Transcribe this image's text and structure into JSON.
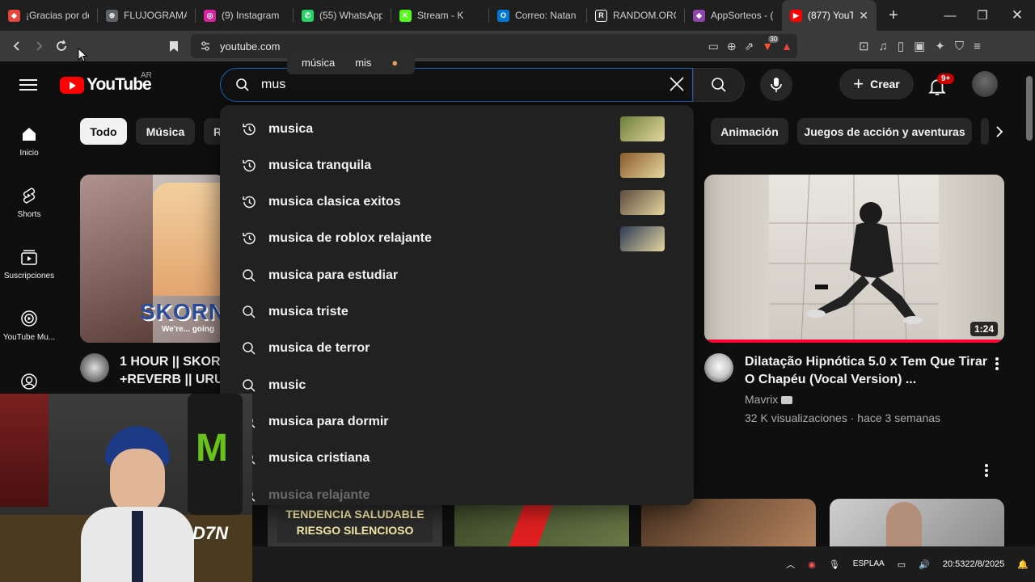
{
  "browser": {
    "tabs": [
      {
        "title": "¡Gracias por de",
        "fav_color": "#e8453c",
        "fav_glyph": "◆"
      },
      {
        "title": "FLUJOGRAMA",
        "fav_color": "#5f6368",
        "fav_glyph": "⊕"
      },
      {
        "title": "(9) Instagram",
        "fav_color": "#d6249f",
        "fav_glyph": "◎"
      },
      {
        "title": "(55) WhatsApp",
        "fav_color": "#25d366",
        "fav_glyph": "✆"
      },
      {
        "title": "Stream - K",
        "fav_color": "#53fc18",
        "fav_glyph": "K"
      },
      {
        "title": "Correo: Natan",
        "fav_color": "#0078d4",
        "fav_glyph": "O"
      },
      {
        "title": "RANDOM.ORG",
        "fav_color": "#ffffff",
        "fav_glyph": "R"
      },
      {
        "title": "AppSorteos - (",
        "fav_color": "#8e44ad",
        "fav_glyph": "◆"
      },
      {
        "title": "(877) YouT",
        "fav_color": "#ff0000",
        "fav_glyph": "▶"
      }
    ],
    "url": "youtube.com",
    "brave_count": "30"
  },
  "voice_hint": {
    "word1": "música",
    "word2": "mis"
  },
  "header": {
    "logo_text": "YouTube",
    "country": "AR",
    "search_value": "mus",
    "create_label": "Crear",
    "notif_badge": "9+"
  },
  "sidebar": {
    "items": [
      {
        "label": "Inicio",
        "icon": "home-icon"
      },
      {
        "label": "Shorts",
        "icon": "shorts-icon"
      },
      {
        "label": "Suscripciones",
        "icon": "subscriptions-icon"
      },
      {
        "label": "YouTube Mu...",
        "icon": "youtube-music-icon"
      },
      {
        "label": "",
        "icon": "account-icon"
      }
    ]
  },
  "chips": [
    "Todo",
    "Música",
    "R",
    "Animación",
    "Juegos de acción y aventuras"
  ],
  "suggestions": [
    {
      "text": "musica",
      "kind": "history",
      "thumb": "#6c7f3a"
    },
    {
      "text": "musica tranquila",
      "kind": "history",
      "thumb": "#8a5a2a"
    },
    {
      "text": "musica clasica exitos",
      "kind": "history",
      "thumb": "#5b4a3c"
    },
    {
      "text": "musica de roblox relajante",
      "kind": "history",
      "thumb": "#2c3b55"
    },
    {
      "text": "musica para estudiar",
      "kind": "search"
    },
    {
      "text": "musica triste",
      "kind": "search"
    },
    {
      "text": "musica de terror",
      "kind": "search"
    },
    {
      "text": "music",
      "kind": "search"
    },
    {
      "text": "musica para dormir",
      "kind": "search"
    },
    {
      "text": "musica cristiana",
      "kind": "search"
    },
    {
      "text": "musica relajante",
      "kind": "search"
    }
  ],
  "videos": {
    "left": {
      "title_line1": "1 HOUR || SKORN",
      "title_line2": "+REVERB || URUM",
      "overlay_text": "SKORN",
      "overlay_sub": "We're... going"
    },
    "right": {
      "title": "Dilatação Hipnótica 5.0 x Tem Que Tirar O Chapéu (Vocal Version) ...",
      "channel": "Mavrix",
      "meta": "32 K visualizaciones · hace 3 semanas",
      "duration": "1:24"
    },
    "shorts_row": {
      "thumb1_line1": "TENDENCIA SALUDABLE",
      "thumb1_line2": "RIESGO SILENCIOSO"
    }
  },
  "webcam": {
    "logo_text": "D7N"
  },
  "taskbar": {
    "lang_line1": "ESP",
    "lang_line2": "LAA",
    "time": "20:53",
    "date": "22/8/2025"
  }
}
